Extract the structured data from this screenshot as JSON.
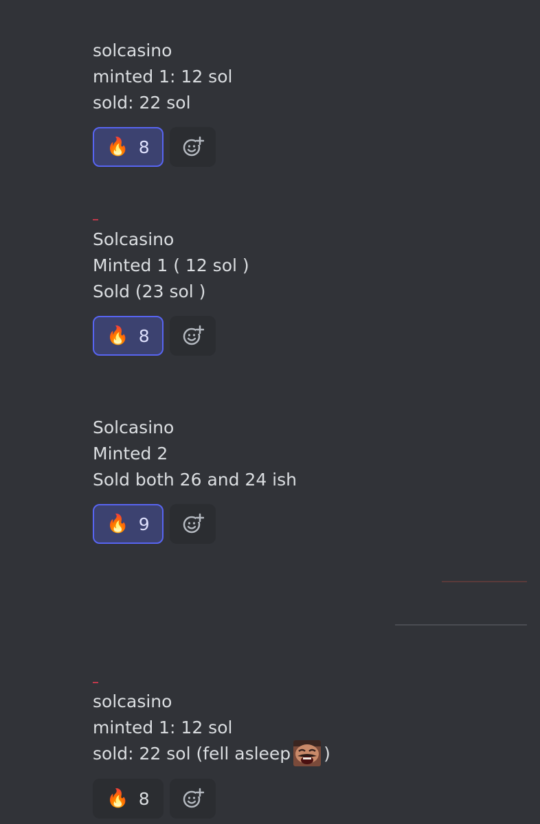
{
  "messages": [
    {
      "lines": [
        "solcasino",
        "minted 1: 12 sol",
        "sold: 22 sol"
      ],
      "reaction": {
        "emoji": "🔥",
        "count": "8",
        "selected": true
      }
    },
    {
      "lines": [
        "Solcasino",
        "Minted 1 ( 12 sol )",
        "Sold (23 sol )"
      ],
      "reaction": {
        "emoji": "🔥",
        "count": "8",
        "selected": true
      }
    },
    {
      "lines": [
        "Solcasino",
        "Minted 2",
        "Sold both 26 and 24 ish"
      ],
      "reaction": {
        "emoji": "🔥",
        "count": "9",
        "selected": true
      }
    },
    {
      "lines": [
        "solcasino",
        "minted 1: 12 sol",
        "sold: 22 sol (fell asleep",
        ")"
      ],
      "reaction": {
        "emoji": "🔥",
        "count": "8",
        "selected": false
      }
    }
  ],
  "icons": {
    "reaction_emoji": "fire-icon",
    "add_reaction": "add-reaction-icon",
    "inline_emote": "laughing-face-emote"
  },
  "colors": {
    "background": "#313338",
    "text": "#dbdee1",
    "reaction_bg": "#2b2d31",
    "selected_reaction_bg": "#3c4270",
    "selected_reaction_border": "#5865f2"
  }
}
